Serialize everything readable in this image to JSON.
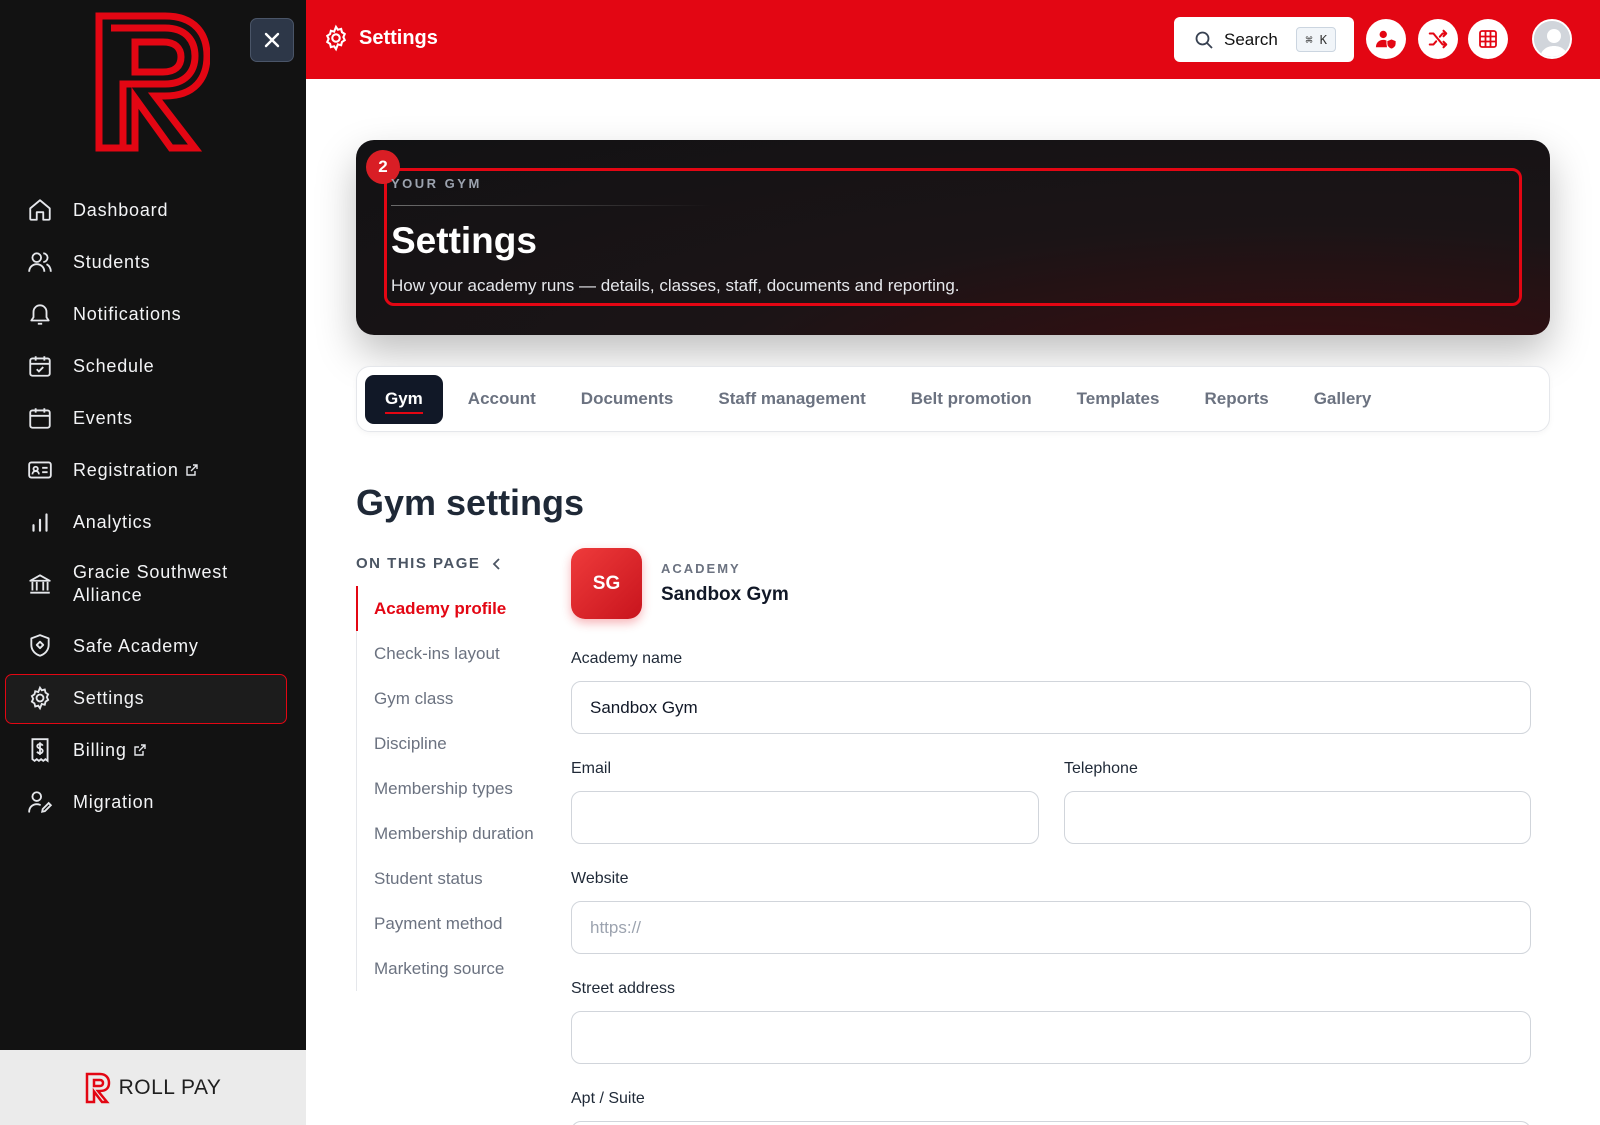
{
  "sidebar": {
    "items": [
      {
        "label": "Dashboard",
        "icon": "home-icon"
      },
      {
        "label": "Students",
        "icon": "users-icon"
      },
      {
        "label": "Notifications",
        "icon": "bell-icon"
      },
      {
        "label": "Schedule",
        "icon": "calendar-check-icon"
      },
      {
        "label": "Events",
        "icon": "calendar-icon"
      },
      {
        "label": "Registration",
        "icon": "id-card-icon",
        "external": true
      },
      {
        "label": "Analytics",
        "icon": "bar-chart-icon"
      },
      {
        "label": "Gracie Southwest Alliance",
        "icon": "bank-icon"
      },
      {
        "label": "Safe Academy",
        "icon": "shield-icon"
      },
      {
        "label": "Settings",
        "icon": "gear-icon",
        "active": true
      },
      {
        "label": "Billing",
        "icon": "receipt-dollar-icon",
        "external": true
      },
      {
        "label": "Migration",
        "icon": "user-edit-icon"
      }
    ],
    "footer_brand": "ROLL PAY"
  },
  "topbar": {
    "title": "Settings",
    "search_label": "Search",
    "search_shortcut": "⌘ K",
    "actions": [
      "user-shield-icon",
      "shuffle-icon",
      "grid-icon"
    ]
  },
  "hero": {
    "badge": "2",
    "eyebrow": "YOUR GYM",
    "title": "Settings",
    "subtitle": "How your academy runs — details, classes, staff, documents and reporting."
  },
  "tabs": [
    "Gym",
    "Account",
    "Documents",
    "Staff management",
    "Belt promotion",
    "Templates",
    "Reports",
    "Gallery"
  ],
  "active_tab": "Gym",
  "section": {
    "title": "Gym settings",
    "on_this_page": "ON THIS PAGE",
    "toc": [
      "Academy profile",
      "Check-ins layout",
      "Gym class",
      "Discipline",
      "Membership types",
      "Membership duration",
      "Student status",
      "Payment method",
      "Marketing source"
    ],
    "active_toc": "Academy profile"
  },
  "academy": {
    "initials": "SG",
    "eyebrow": "ACADEMY",
    "name": "Sandbox Gym"
  },
  "form": {
    "academy_name_label": "Academy name",
    "academy_name_value": "Sandbox Gym",
    "email_label": "Email",
    "email_value": "",
    "telephone_label": "Telephone",
    "telephone_value": "",
    "website_label": "Website",
    "website_placeholder": "https://",
    "street_label": "Street address",
    "street_value": "",
    "apt_label": "Apt / Suite"
  },
  "colors": {
    "brand_red": "#e30613",
    "sidebar_bg": "#121212",
    "tab_active_bg": "#111827"
  }
}
